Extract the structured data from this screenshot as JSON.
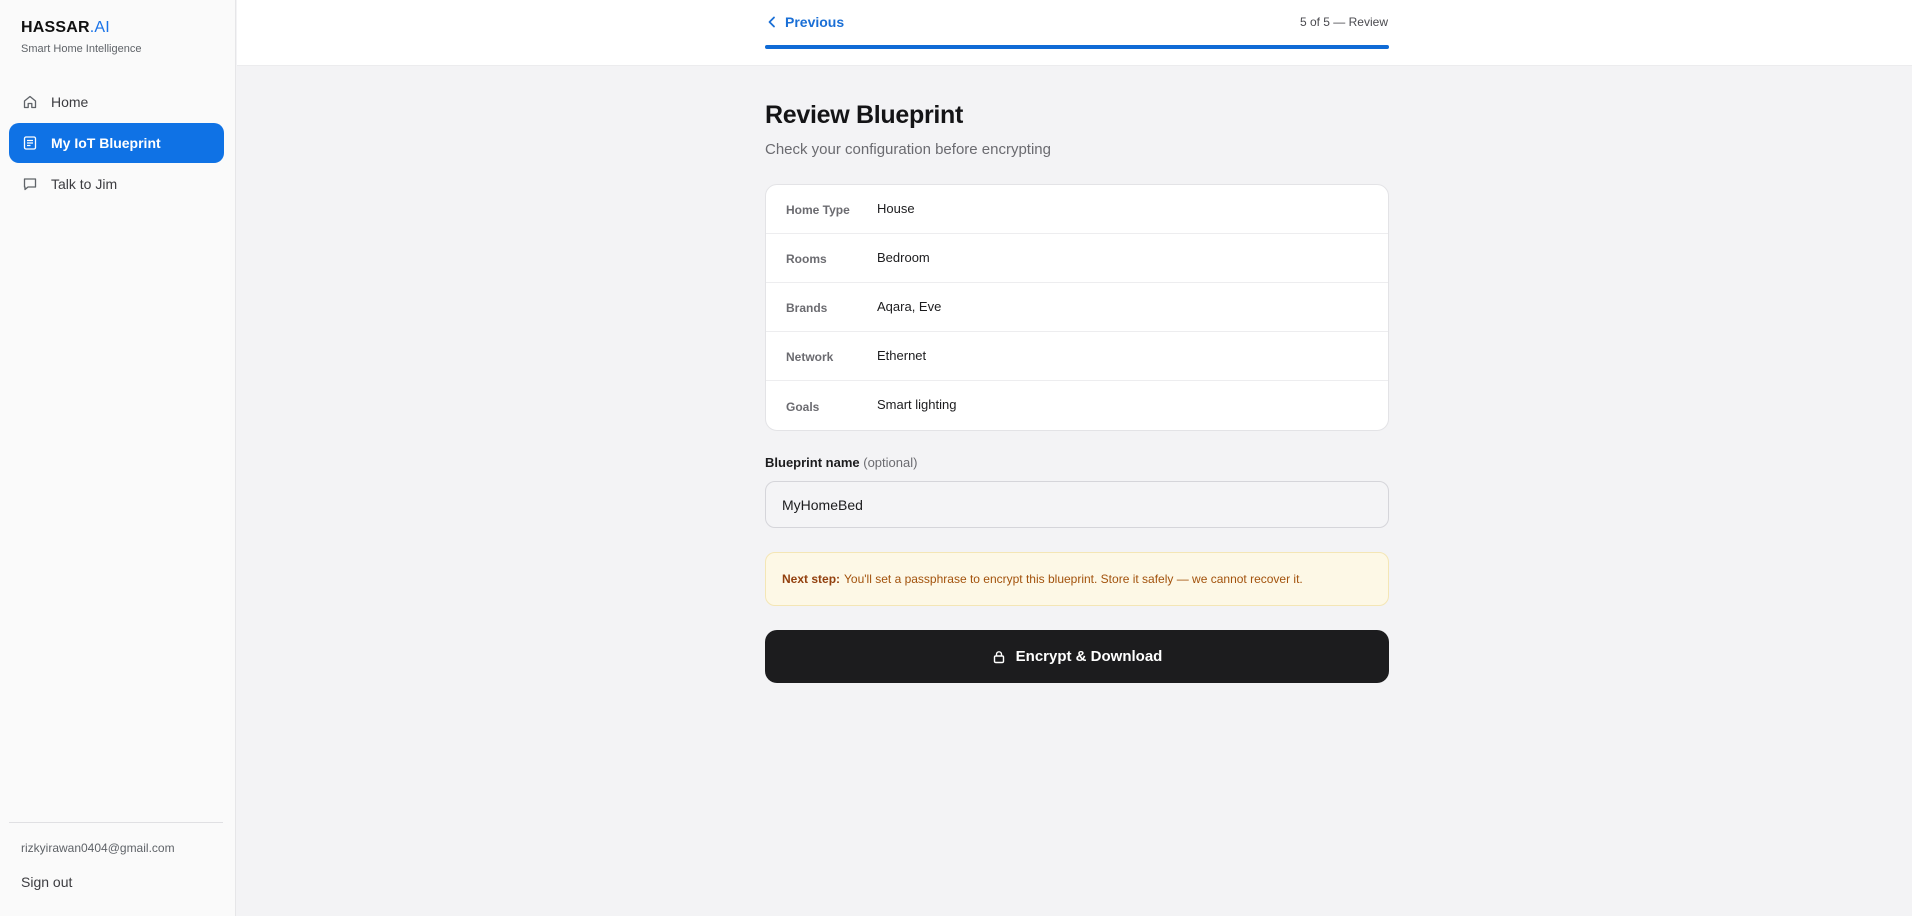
{
  "brand": {
    "name": "HASSAR",
    "suffix": ".AI",
    "tagline": "Smart Home Intelligence"
  },
  "sidebar": {
    "items": [
      {
        "label": "Home",
        "icon": "home-icon",
        "active": false
      },
      {
        "label": "My IoT Blueprint",
        "icon": "document-icon",
        "active": true
      },
      {
        "label": "Talk to Jim",
        "icon": "chat-icon",
        "active": false
      }
    ],
    "user_email": "rizkyirawan0404@gmail.com",
    "signout_label": "Sign out"
  },
  "topbar": {
    "previous_label": "Previous",
    "step_label": "5 of 5 — Review",
    "progress": 1.0
  },
  "main": {
    "title": "Review Blueprint",
    "subtitle": "Check your configuration before encrypting",
    "summary": [
      {
        "label": "Home Type",
        "value": "House"
      },
      {
        "label": "Rooms",
        "value": "Bedroom"
      },
      {
        "label": "Brands",
        "value": "Aqara, Eve"
      },
      {
        "label": "Network",
        "value": "Ethernet"
      },
      {
        "label": "Goals",
        "value": "Smart lighting"
      }
    ],
    "name_field": {
      "label": "Blueprint name",
      "optional": "(optional)",
      "value": "MyHomeBed"
    },
    "notice": {
      "bold": "Next step:",
      "text": "You'll set a passphrase to encrypt this blueprint. Store it safely — we cannot recover it."
    },
    "encrypt_label": "Encrypt & Download"
  },
  "colors": {
    "accent": "#0f72e5",
    "button_dark": "#1c1c1e",
    "notice_bg": "#fdf8e6",
    "notice_text": "#a2520c"
  }
}
